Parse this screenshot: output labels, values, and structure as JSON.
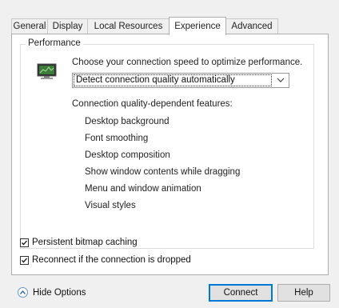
{
  "tabs": [
    {
      "label": "General"
    },
    {
      "label": "Display"
    },
    {
      "label": "Local Resources"
    },
    {
      "label": "Experience",
      "active": true
    },
    {
      "label": "Advanced"
    }
  ],
  "performance": {
    "group_title": "Performance",
    "speed_label": "Choose your connection speed to optimize performance.",
    "speed_selected": "Detect connection quality automatically",
    "features_label": "Connection quality-dependent features:",
    "features": [
      "Desktop background",
      "Font smoothing",
      "Desktop composition",
      "Show window contents while dragging",
      "Menu and window animation",
      "Visual styles"
    ]
  },
  "options": [
    {
      "label": "Persistent bitmap caching",
      "checked": true
    },
    {
      "label": "Reconnect if the connection is dropped",
      "checked": true
    }
  ],
  "footer": {
    "hide_options": "Hide Options",
    "connect": "Connect",
    "help": "Help"
  },
  "colors": {
    "accent": "#0078d7",
    "panel_bg": "#ffffff",
    "window_bg": "#f0f0f0"
  },
  "icons": {
    "monitor": "monitor-icon",
    "dropdown": "chevron-down-icon",
    "collapse": "chevron-up-icon",
    "check": "check-icon"
  }
}
